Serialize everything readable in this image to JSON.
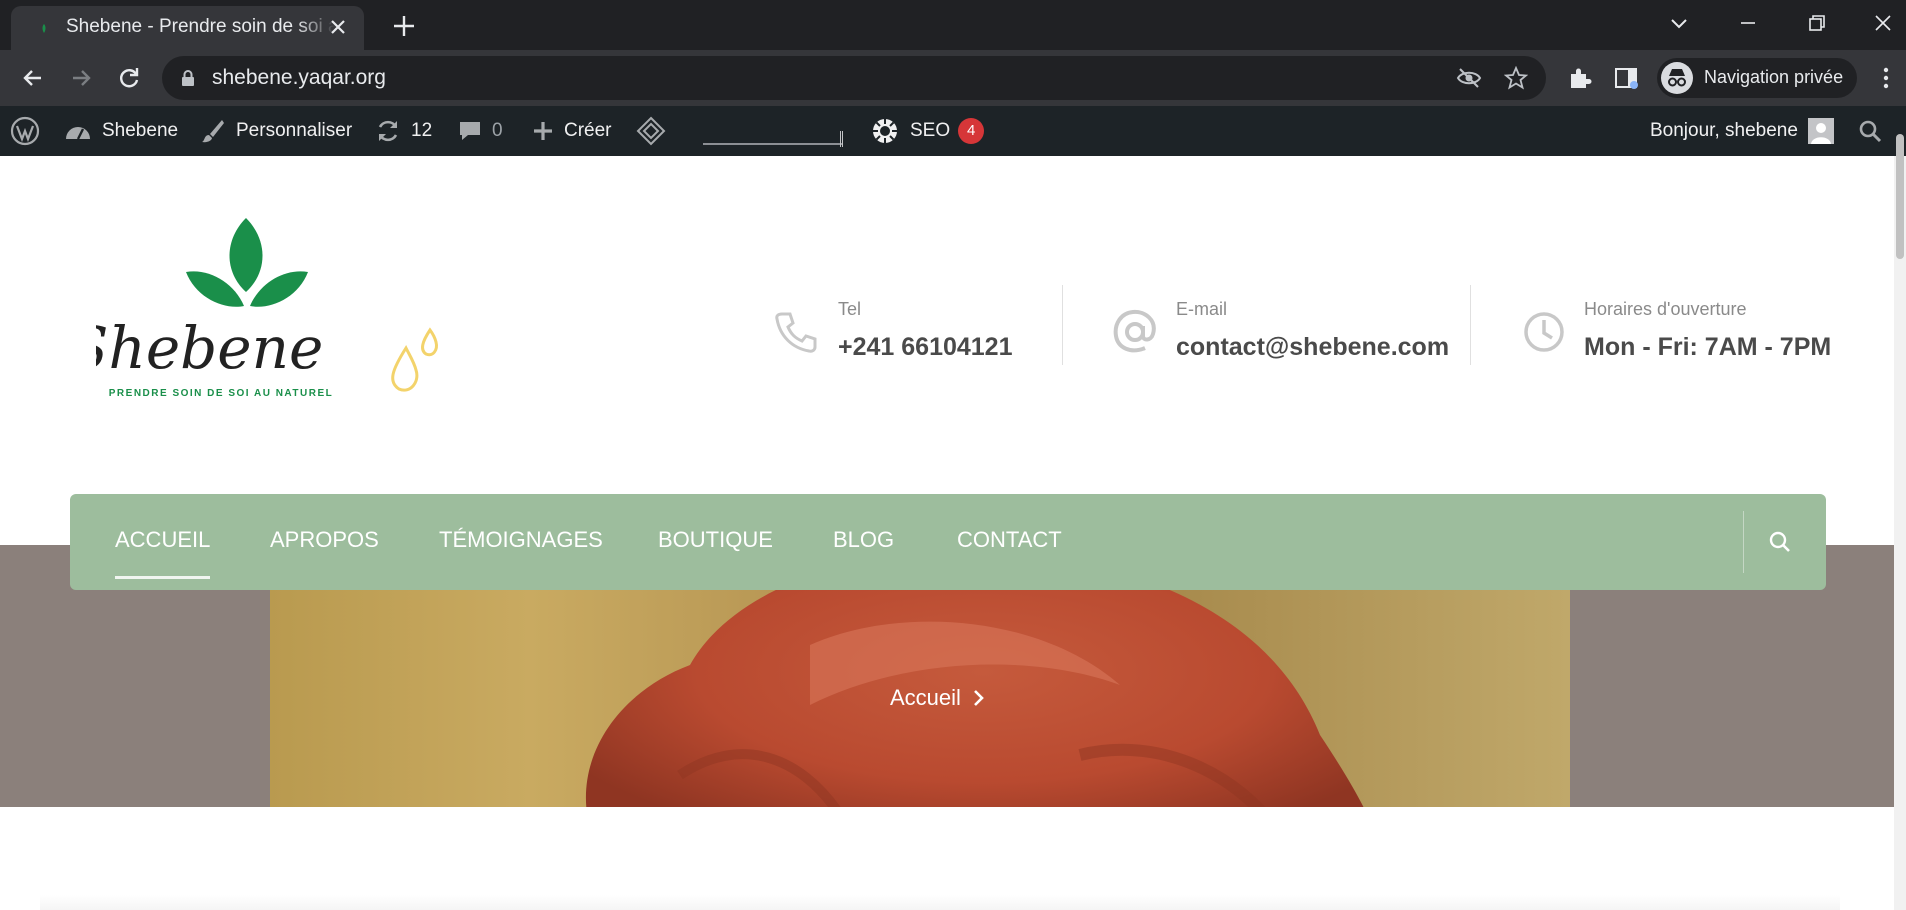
{
  "browser": {
    "tab_title": "Shebene - Prendre soin de soi au naturel",
    "url": "shebene.yaqar.org",
    "profile_label": "Navigation privée"
  },
  "adminbar": {
    "site_name": "Shebene",
    "customize": "Personnaliser",
    "updates_count": "12",
    "comments_count": "0",
    "create": "Créer",
    "seo": "SEO",
    "seo_badge": "4",
    "greeting": "Bonjour, shebene"
  },
  "header": {
    "logo_text": "Shebene",
    "logo_tagline": "PRENDRE SOIN DE SOI AU NATUREL",
    "contacts": [
      {
        "label": "Tel",
        "value": "+241 66104121",
        "icon": "phone-icon"
      },
      {
        "label": "E-mail",
        "value": "contact@shebene.com",
        "icon": "at-icon"
      },
      {
        "label": "Horaires d'ouverture",
        "value": "Mon - Fri: 7AM - 7PM",
        "icon": "clock-icon"
      }
    ]
  },
  "nav": {
    "items": [
      "ACCUEIL",
      "APROPOS",
      "TÉMOIGNAGES",
      "BOUTIQUE",
      "BLOG",
      "CONTACT"
    ],
    "active": "ACCUEIL"
  },
  "hero": {
    "breadcrumb": "Accueil"
  },
  "colors": {
    "nav_bg": "#9dbd9d",
    "logo_green": "#1a8f4a",
    "logo_gold": "#f3d36b",
    "adminbar_bg": "#1d2327",
    "seo_badge_bg": "#d63638"
  }
}
